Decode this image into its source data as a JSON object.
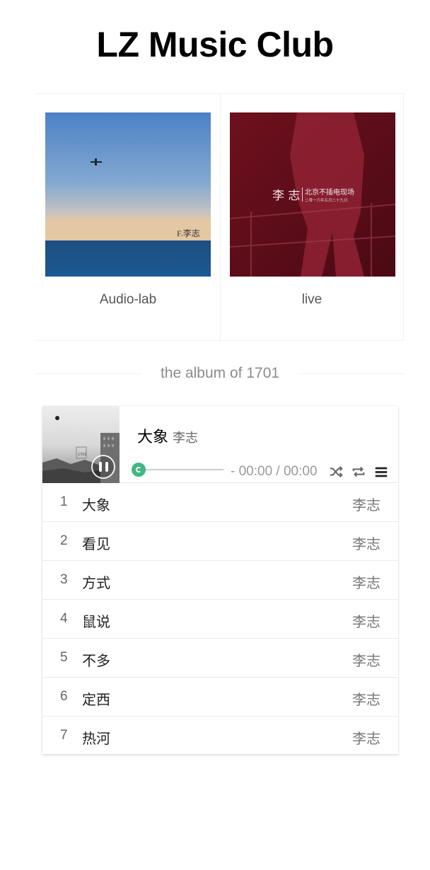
{
  "site": {
    "title": "LZ Music Club"
  },
  "albums": [
    {
      "name": "Audio-lab",
      "cover_text": "F.李志"
    },
    {
      "name": "live",
      "cover_artist": "李 志",
      "cover_subtitle": "北京不插电现场",
      "cover_date": "二零一六年五月二十九日"
    }
  ],
  "section": {
    "label": "the album of 1701"
  },
  "player": {
    "now_playing": {
      "title": "大象",
      "artist": "李志"
    },
    "time": "- 00:00 / 00:00",
    "progress": 0,
    "cover_mark": "1701",
    "controls": [
      "shuffle-icon",
      "repeat-icon",
      "playlist-menu-icon"
    ],
    "accent": "#41b883"
  },
  "tracks": [
    {
      "num": "1",
      "title": "大象",
      "artist": "李志"
    },
    {
      "num": "2",
      "title": "看见",
      "artist": "李志"
    },
    {
      "num": "3",
      "title": "方式",
      "artist": "李志"
    },
    {
      "num": "4",
      "title": "鼠说",
      "artist": "李志"
    },
    {
      "num": "5",
      "title": "不多",
      "artist": "李志"
    },
    {
      "num": "6",
      "title": "定西",
      "artist": "李志"
    },
    {
      "num": "7",
      "title": "热河",
      "artist": "李志"
    }
  ]
}
